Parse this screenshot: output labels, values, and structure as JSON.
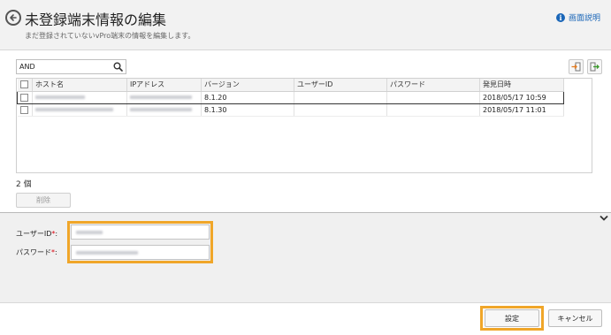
{
  "header": {
    "title": "未登録端末情報の編集",
    "subtitle": "まだ登録されていないvPro端末の情報を編集します。",
    "help_label": "画面説明"
  },
  "search": {
    "value": "AND"
  },
  "grid": {
    "columns": [
      "ホスト名",
      "IPアドレス",
      "バージョン",
      "ユーザーID",
      "パスワード",
      "発見日時"
    ],
    "rows": [
      {
        "version": "8.1.20",
        "discovered": "2018/05/17 10:59"
      },
      {
        "version": "8.1.30",
        "discovered": "2018/05/17 11:01"
      }
    ]
  },
  "count_label": "2 個",
  "delete_label": "削除",
  "form": {
    "user_id_label": "ユーザーID",
    "password_label": "パスワード",
    "required_mark": "*",
    "colon": ":"
  },
  "footer": {
    "set_label": "設定",
    "cancel_label": "キャンセル"
  },
  "colors": {
    "highlight": "#f0a629",
    "link": "#1a66b8",
    "required": "#d9000d"
  },
  "icons": {
    "back": "back-arrow-icon",
    "help": "info-icon",
    "search": "search-icon",
    "import": "import-icon",
    "export": "export-icon",
    "collapse": "chevron-down-icon"
  }
}
